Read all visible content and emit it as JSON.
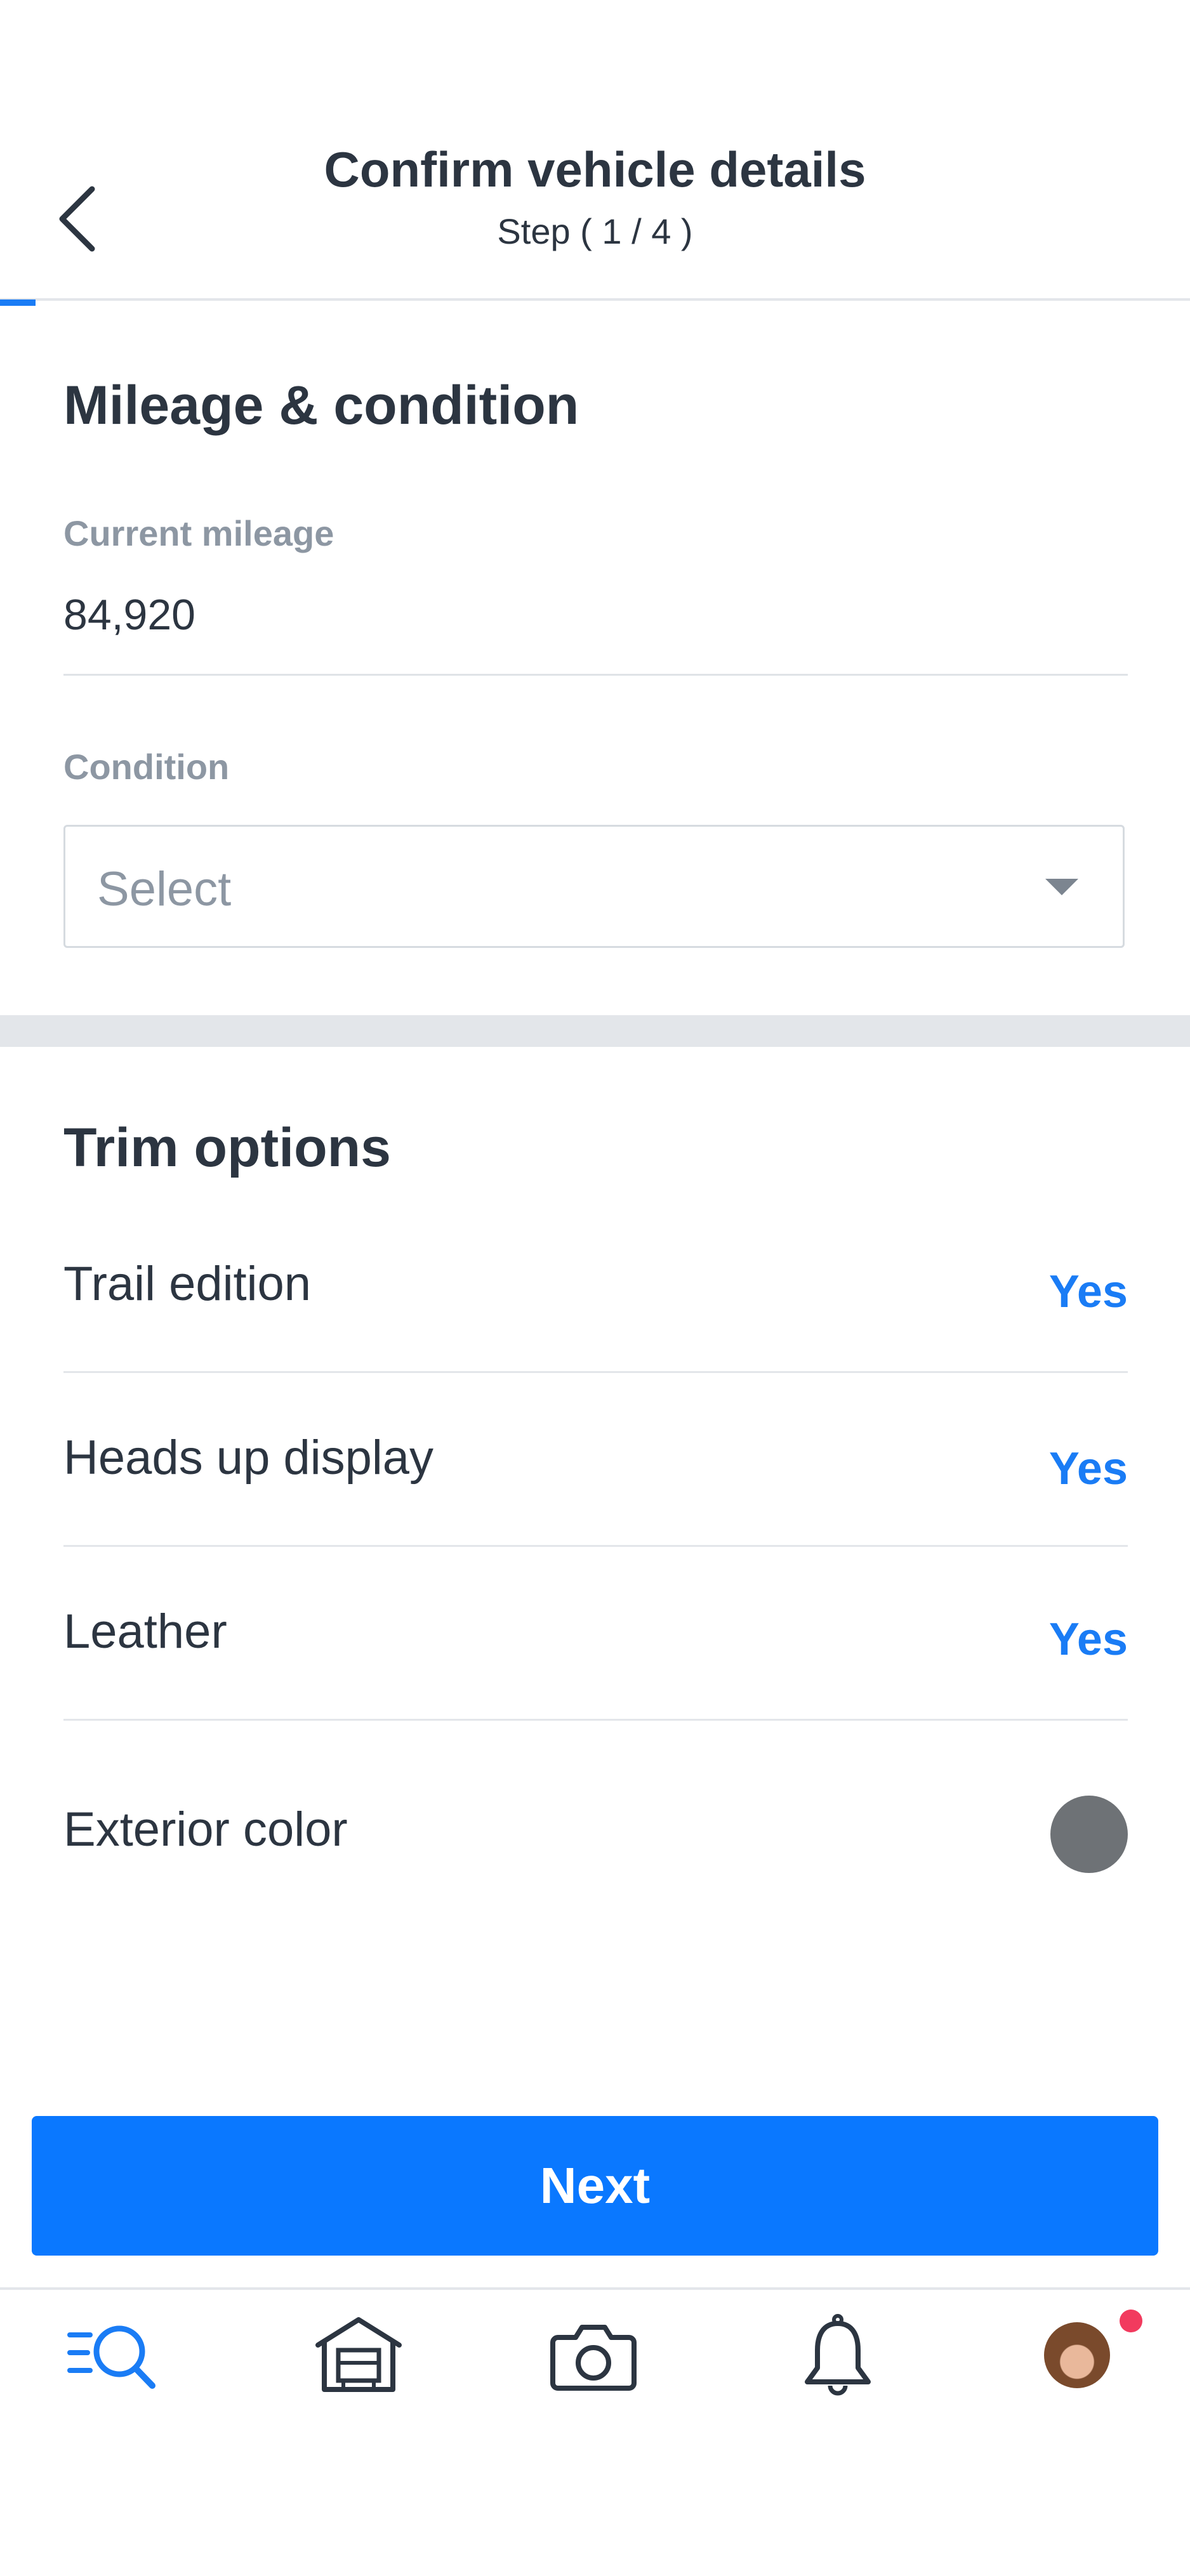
{
  "header": {
    "title": "Confirm vehicle details",
    "step": "Step ( 1 / 4 )"
  },
  "progress": {
    "fraction": 0.03,
    "color": "#1a7cf5"
  },
  "mileage_section": {
    "title": "Mileage & condition",
    "mileage_label": "Current mileage",
    "mileage_value": "84,920",
    "condition_label": "Condition",
    "condition_placeholder": "Select"
  },
  "trim": {
    "title": "Trim options",
    "items": [
      {
        "label": "Trail edition",
        "value": "Yes"
      },
      {
        "label": "Heads up display",
        "value": "Yes"
      },
      {
        "label": "Leather",
        "value": "Yes"
      }
    ],
    "exterior_color_label": "Exterior color",
    "exterior_color": "#6e7276"
  },
  "actions": {
    "next_label": "Next",
    "accent": "#0a78ff"
  },
  "tabbar": {
    "items": [
      "search-icon",
      "garage-icon",
      "camera-icon",
      "bell-icon",
      "avatar"
    ],
    "active": "search-icon",
    "notification_dot_color": "#f23a5e"
  }
}
